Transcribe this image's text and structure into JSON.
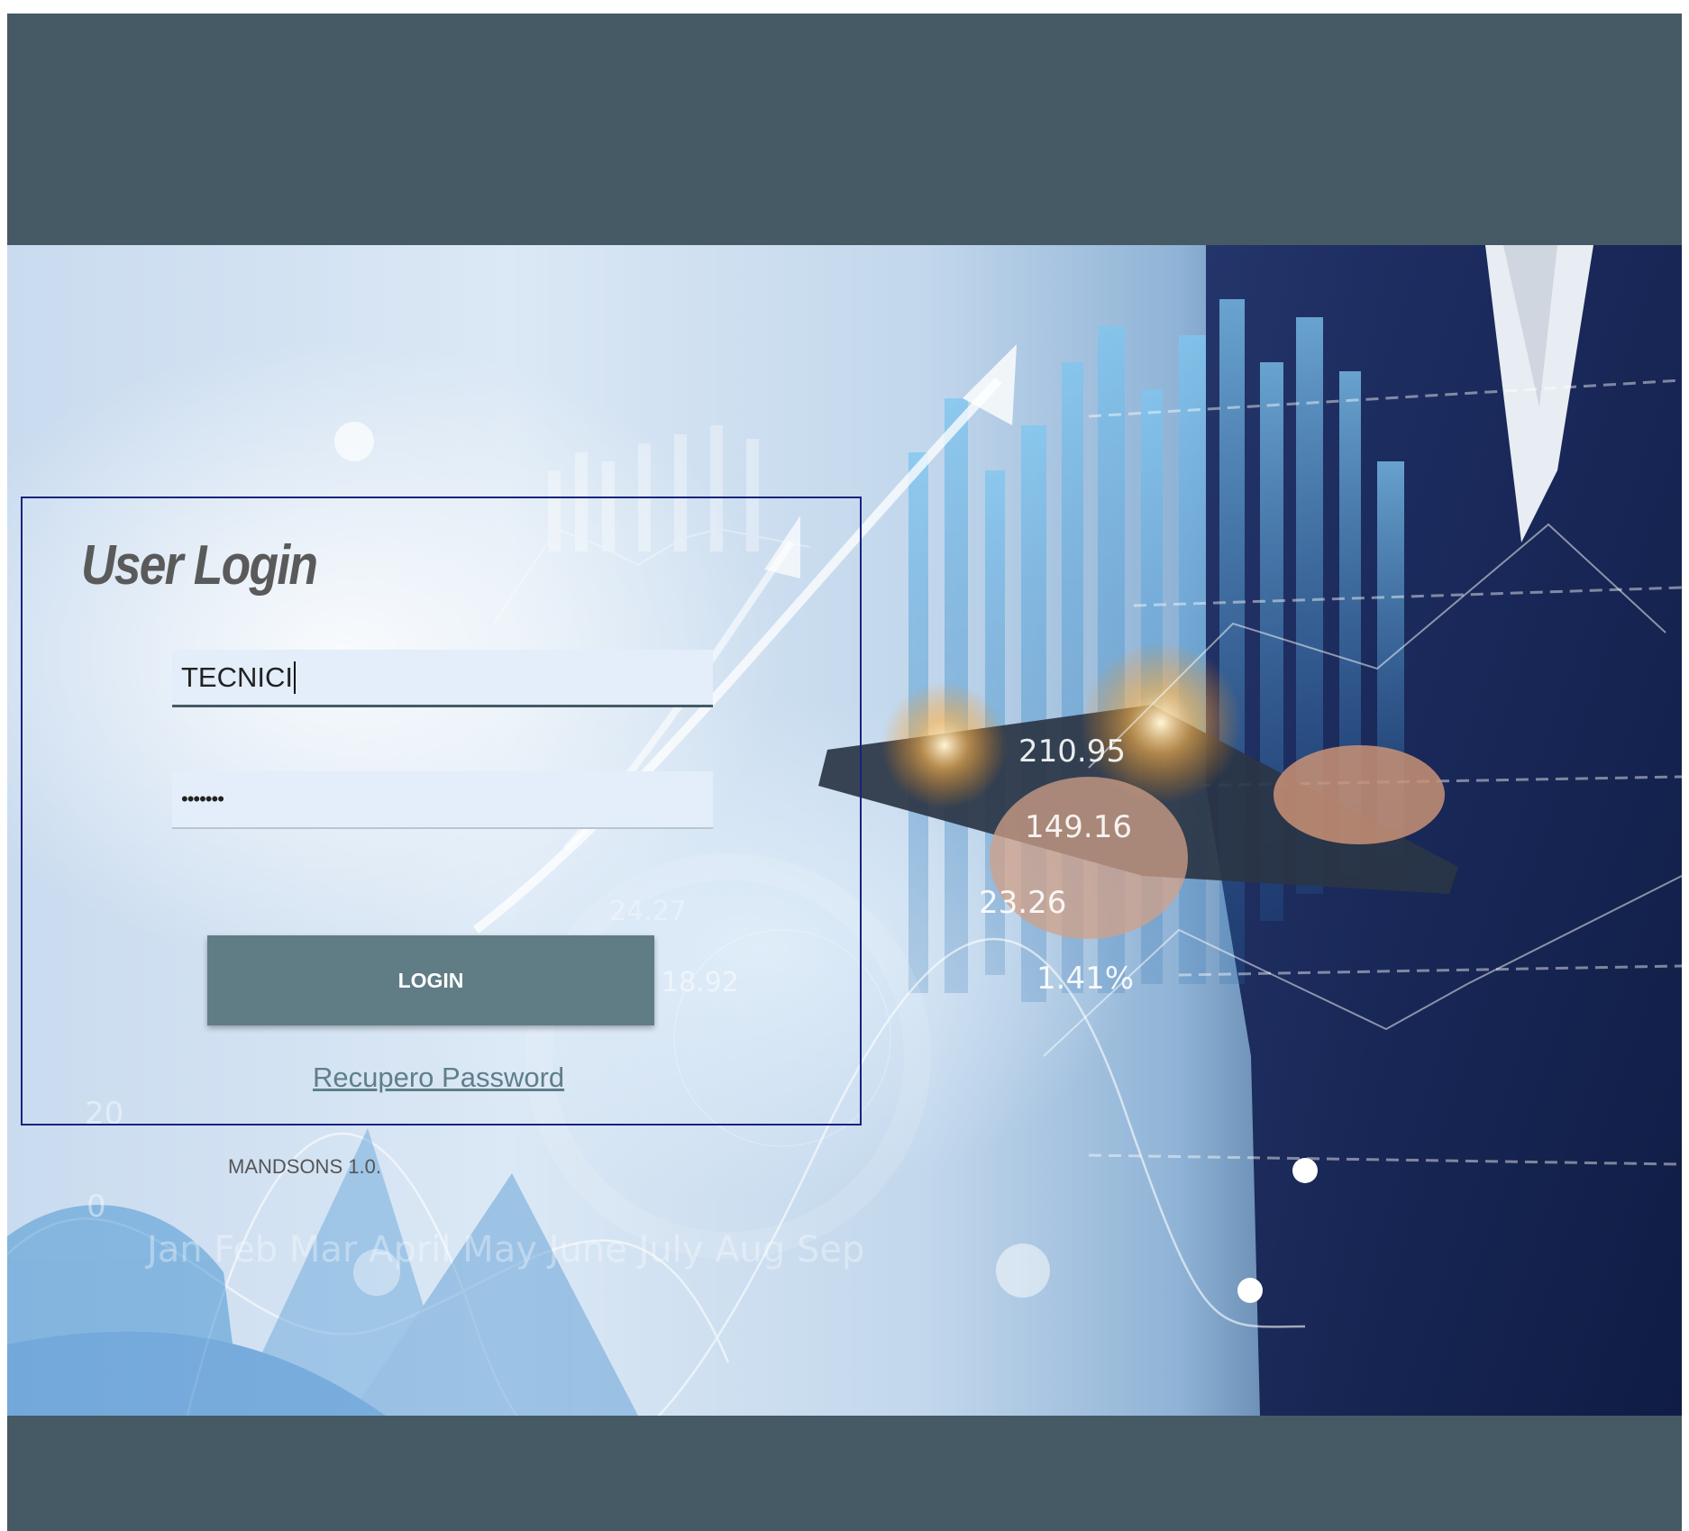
{
  "login": {
    "title": "User Login",
    "username_value": "TECNICI",
    "password_masked": "•••••••",
    "login_button_label": "LOGIN",
    "recover_password_label": "Recupero Password"
  },
  "footer": {
    "version": "MANDSONS 1.0."
  },
  "hero_overlay_text": {
    "value_1": "210.95",
    "value_2": "149.16",
    "value_3": "23.26",
    "value_4": "1.41%",
    "faint_1": "24.27",
    "faint_2": "18.92",
    "axis_0": "0",
    "axis_20": "20",
    "month_labels": "Jan Feb Mar April May June July Aug Sep"
  },
  "colors": {
    "header_bar": "#455a64",
    "button": "#607d85",
    "box_border": "#1a237e",
    "link": "#5f7f8a"
  }
}
